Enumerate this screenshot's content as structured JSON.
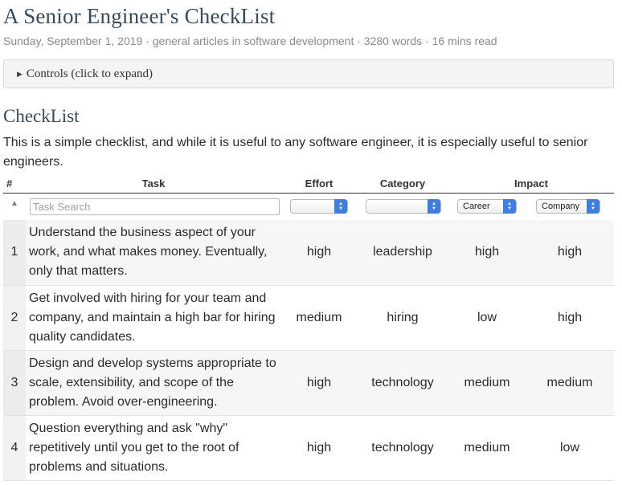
{
  "article": {
    "title": "A Senior Engineer's CheckList",
    "date": "Sunday, September 1, 2019",
    "category": "general articles in software development",
    "words": "3280 words",
    "read_time": "16 mins read",
    "separator": " · "
  },
  "controls": {
    "label": "Controls (click to expand)"
  },
  "section": {
    "heading": "CheckList",
    "intro": "This is a simple checklist, and while it is useful to any software engineer, it is especially useful to senior engineers."
  },
  "table": {
    "headers": {
      "num": "#",
      "task": "Task",
      "effort": "Effort",
      "category": "Category",
      "impact": "Impact"
    },
    "filters": {
      "task_placeholder": "Task Search",
      "effort_value": "",
      "category_value": "",
      "impact_career": "Career",
      "impact_company": "Company"
    },
    "rows": [
      {
        "num": "1",
        "task": "Understand the business aspect of your work, and what makes money. Eventually, only that matters.",
        "effort": "high",
        "category": "leadership",
        "career": "high",
        "company": "high"
      },
      {
        "num": "2",
        "task": "Get involved with hiring for your team and company, and maintain a high bar for hiring quality candidates.",
        "effort": "medium",
        "category": "hiring",
        "career": "low",
        "company": "high"
      },
      {
        "num": "3",
        "task": "Design and develop systems appropriate to scale, extensibility, and scope of the problem. Avoid over-engineering.",
        "effort": "high",
        "category": "technology",
        "career": "medium",
        "company": "medium"
      },
      {
        "num": "4",
        "task": "Question everything and ask \"why\" repetitively until you get to the root of problems and situations.",
        "effort": "high",
        "category": "technology",
        "career": "medium",
        "company": "low"
      }
    ]
  },
  "icons": {
    "sort": "sort-ascending-icon",
    "expand": "caret-right-icon",
    "select": "select-arrows-icon"
  }
}
